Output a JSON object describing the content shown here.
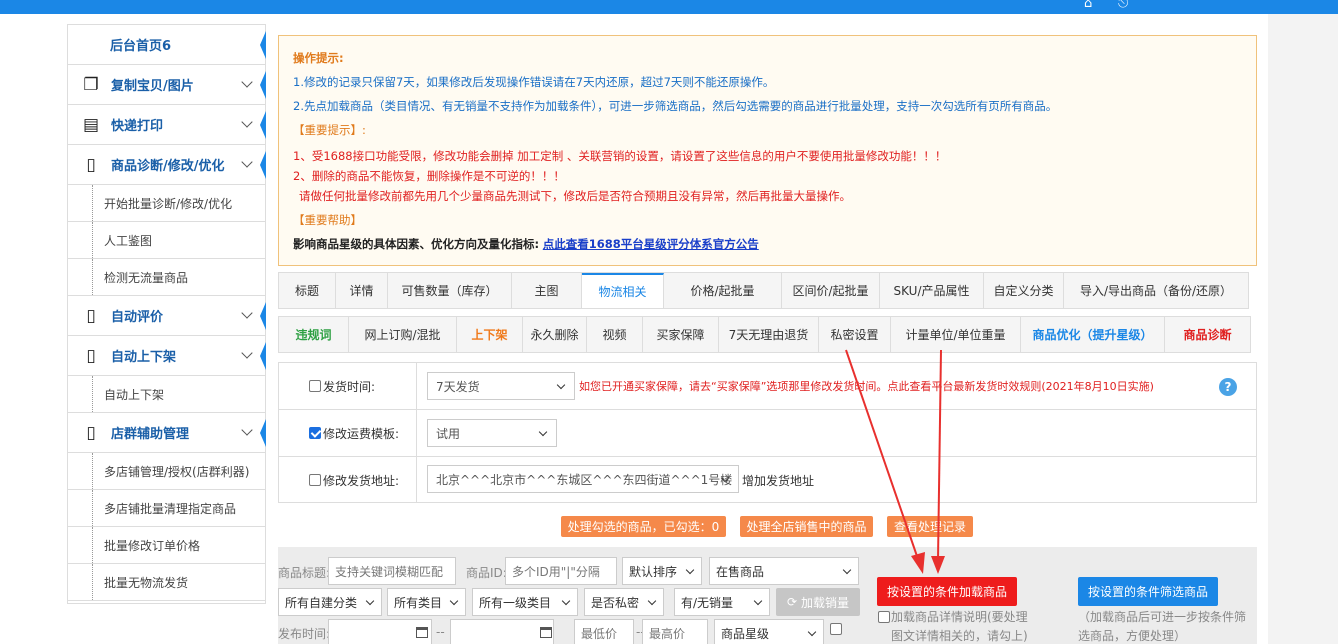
{
  "sidebar": {
    "home": "后台首页6",
    "items": [
      {
        "label": "复制宝贝/图片",
        "icon": "copy-icon"
      },
      {
        "label": "快递打印",
        "icon": "printer-icon"
      },
      {
        "label": "商品诊断/修改/优化",
        "icon": "clipboard-icon"
      },
      {
        "label": "开始批量诊断/修改/优化"
      },
      {
        "label": "人工鉴图"
      },
      {
        "label": "检测无流量商品"
      },
      {
        "label": "自动评价",
        "icon": "clipboard-icon"
      },
      {
        "label": "自动上下架",
        "icon": "clipboard-icon"
      },
      {
        "label": "自动上下架"
      },
      {
        "label": "店群辅助管理",
        "icon": "clipboard-icon"
      },
      {
        "label": "多店铺管理/授权(店群利器)"
      },
      {
        "label": "多店铺批量清理指定商品"
      },
      {
        "label": "批量修改订单价格"
      },
      {
        "label": "批量无物流发货"
      }
    ]
  },
  "tips": {
    "title": "操作提示:",
    "line1": "1.修改的记录只保留7天，如果修改后发现操作错误请在7天内还原，超过7天则不能还原操作。",
    "line2": "2.先点加载商品（类目情况、有无销量不支持作为加载条件），可进一步筛选商品，然后勾选需要的商品进行批量处理，支持一次勾选所有页所有商品。",
    "important": "【重要提示】:",
    "red1": "1、受1688接口功能受限，修改功能会删掉 加工定制 、关联营销的设置，请设置了这些信息的用户不要使用批量修改功能！！！",
    "red2": "2、删除的商品不能恢复，删除操作是不可逆的！！！",
    "red3": "请做任何批量修改前都先用几个少量商品先测试下，修改后是否符合预期且没有异常，然后再批量大量操作。",
    "help": "【重要帮助】",
    "factors": "影响商品星级的具体因素、优化方向及量化指标:",
    "link": "点此查看1688平台星级评分体系官方公告"
  },
  "tabs1": [
    "标题",
    "详情",
    "可售数量（库存）",
    "主图",
    "物流相关",
    "价格/起批量",
    "区间价/起批量",
    "SKU/产品属性",
    "自定义分类",
    "导入/导出商品（备份/还原）"
  ],
  "tabs2": [
    "违规词",
    "网上订购/混批",
    "上下架",
    "永久删除",
    "视频",
    "买家保障",
    "7天无理由退货",
    "私密设置",
    "计量单位/单位重量",
    "商品优化（提升星级）",
    "商品诊断"
  ],
  "form": {
    "ship_time_label": "发货时间:",
    "ship_time_value": "7天发货",
    "ship_time_note": "如您已开通买家保障，请去“买家保障”选项那里修改发货时间。点此查看平台最新发货时效规则(2021年8月10日实施)",
    "freight_label": "修改运费模板:",
    "freight_value": "试用",
    "address_label": "修改发货地址:",
    "address_value": "北京^^^北京市^^^东城区^^^东四街道^^^1号楼",
    "add_address": "增加发货地址"
  },
  "actions": {
    "process_checked": "处理勾选的商品，已勾选：0",
    "process_all": "处理全店销售中的商品",
    "view_records": "查看处理记录"
  },
  "filter": {
    "title_label": "商品标题:",
    "title_placeholder": "支持关键词模糊匹配",
    "id_label": "商品ID:",
    "id_placeholder": "多个ID用\"|\"分隔",
    "sort": "默认排序",
    "status": "在售商品",
    "own_cat": "所有自建分类",
    "all_cat": "所有类目",
    "first_cat": "所有一级类目",
    "private": "是否私密",
    "sales": "有/无销量",
    "load_sales": "加载销量",
    "pub_time_label": "发布时间:",
    "dash": "--",
    "min_price": "最低价",
    "max_price": "最高价",
    "star": "商品星级",
    "load_btn": "按设置的条件加载商品",
    "filter_btn": "按设置的条件筛选商品",
    "load_note1": "加载商品详情说明(要处理",
    "load_note2": "图文详情相关的，请勾上)",
    "filter_note1": "（加载商品后可进一步按条件筛",
    "filter_note2": "选商品，方便处理）"
  },
  "colors": {
    "accent": "#1b87e6",
    "danger": "#ee1c1c",
    "warn": "#f5894a"
  }
}
